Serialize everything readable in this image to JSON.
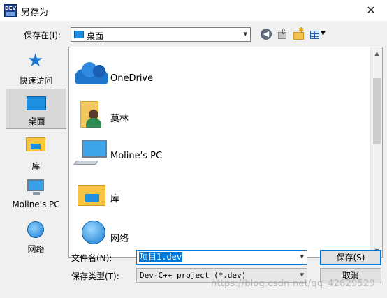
{
  "window": {
    "title": "另存为",
    "app_icon_text": "DEV",
    "close_glyph": "✕"
  },
  "toolbar": {
    "save_in_label": "保存在(I):",
    "save_in_value": "桌面",
    "icons": [
      "back-icon",
      "up-folder-icon",
      "new-folder-icon",
      "view-menu-icon"
    ]
  },
  "places": [
    {
      "label": "快速访问",
      "icon": "quick-access-star-icon",
      "selected": false
    },
    {
      "label": "桌面",
      "icon": "desktop-icon",
      "selected": true
    },
    {
      "label": "库",
      "icon": "library-icon",
      "selected": false
    },
    {
      "label": "Moline's PC",
      "icon": "computer-icon",
      "selected": false
    },
    {
      "label": "网络",
      "icon": "network-icon",
      "selected": false
    }
  ],
  "files": [
    {
      "label": "OneDrive",
      "icon": "onedrive-cloud-icon"
    },
    {
      "label": "莫林",
      "icon": "user-folder-icon"
    },
    {
      "label": "Moline's PC",
      "icon": "computer-icon"
    },
    {
      "label": "库",
      "icon": "library-icon"
    },
    {
      "label": "网络",
      "icon": "network-icon"
    }
  ],
  "form": {
    "filename_label": "文件名(N):",
    "filename_value": "项目1.dev",
    "filetype_label": "保存类型(T):",
    "filetype_value": "Dev-C++ project (*.dev)"
  },
  "buttons": {
    "save": "保存(S)",
    "cancel": "取消"
  },
  "watermark": "https://blog.csdn.net/qq_42629529",
  "colors": {
    "accent": "#0078d7",
    "dialog_bg": "#f0f0f0"
  }
}
